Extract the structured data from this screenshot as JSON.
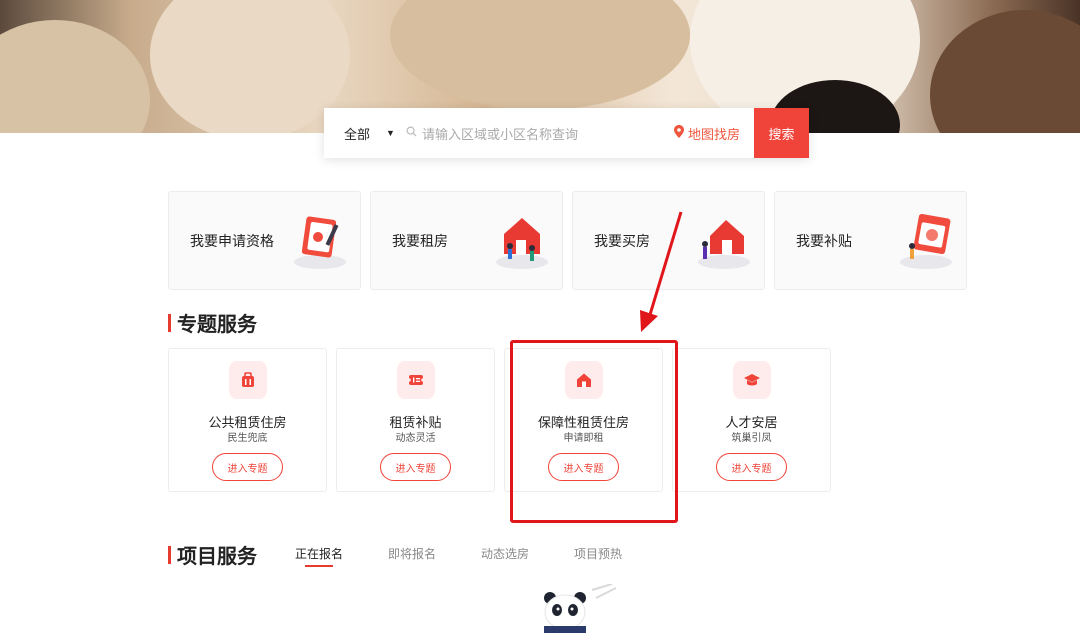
{
  "search": {
    "scope_label": "全部",
    "placeholder": "请输入区域或小区名称查询",
    "map_label": "地图找房",
    "button_label": "搜索"
  },
  "big_cards": [
    {
      "label": "我要申请资格",
      "icon": "application-form-icon"
    },
    {
      "label": "我要租房",
      "icon": "rent-house-icon"
    },
    {
      "label": "我要买房",
      "icon": "buy-house-icon"
    },
    {
      "label": "我要补贴",
      "icon": "subsidy-calendar-icon"
    }
  ],
  "topic_section": {
    "title": "专题服务",
    "items": [
      {
        "name": "公共租赁住房",
        "sub": "民生兜底",
        "button": "进入专题",
        "icon": "suitcase-icon"
      },
      {
        "name": "租赁补贴",
        "sub": "动态灵活",
        "button": "进入专题",
        "icon": "ticket-icon"
      },
      {
        "name": "保障性租赁住房",
        "sub": "申请即租",
        "button": "进入专题",
        "icon": "home-icon"
      },
      {
        "name": "人才安居",
        "sub": "筑巢引凤",
        "button": "进入专题",
        "icon": "graduation-cap-icon"
      }
    ]
  },
  "project_section": {
    "title": "项目服务",
    "tabs": [
      {
        "label": "正在报名",
        "active": true
      },
      {
        "label": "即将报名",
        "active": false
      },
      {
        "label": "动态选房",
        "active": false
      },
      {
        "label": "项目预热",
        "active": false
      }
    ]
  },
  "colors": {
    "accent": "#f0443a",
    "highlight": "#e0161b"
  }
}
